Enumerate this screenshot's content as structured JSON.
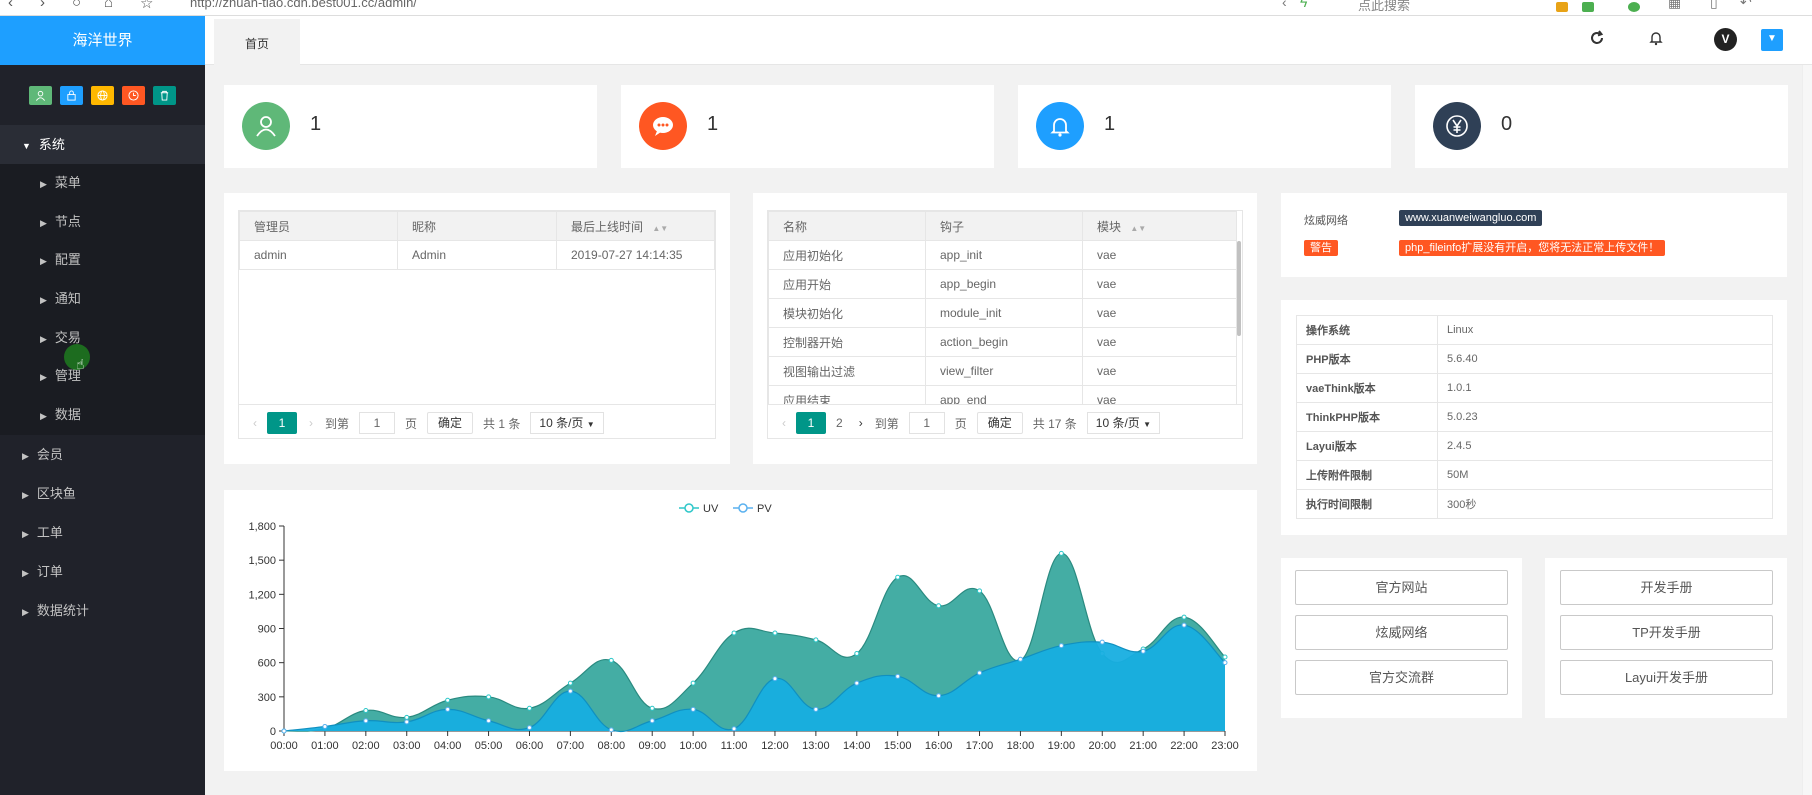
{
  "browser": {
    "url": "http://zhuan-tiao.cdn.best001.cc/admin/",
    "search_placeholder": "点此搜索"
  },
  "sidebar": {
    "logo": "海洋世界",
    "tools": [
      {
        "icon": "user-icon",
        "color": "#5fb878"
      },
      {
        "icon": "lock-icon",
        "color": "#1e9fff"
      },
      {
        "icon": "globe-icon",
        "color": "#ffb800"
      },
      {
        "icon": "clock-icon",
        "color": "#ff5722"
      },
      {
        "icon": "trash-icon",
        "color": "#009688"
      }
    ],
    "menu": [
      {
        "label": "系统",
        "open": true,
        "children": [
          "菜单",
          "节点",
          "配置",
          "通知",
          "交易",
          "管理",
          "数据"
        ]
      },
      {
        "label": "会员"
      },
      {
        "label": "区块鱼"
      },
      {
        "label": "工单"
      },
      {
        "label": "订单"
      },
      {
        "label": "数据统计"
      }
    ]
  },
  "topnav": {
    "tab_home": "首页",
    "avatar": "V"
  },
  "stats": [
    {
      "icon": "user-icon",
      "color": "#5fb878",
      "value": "1"
    },
    {
      "icon": "chat-icon",
      "color": "#ff5722",
      "value": "1"
    },
    {
      "icon": "bell-icon",
      "color": "#1e9fff",
      "value": "1"
    },
    {
      "icon": "yen-icon",
      "color": "#2f4056",
      "value": "0"
    }
  ],
  "admin_table": {
    "headers": [
      "管理员",
      "昵称",
      "最后上线时间"
    ],
    "rows": [
      [
        "admin",
        "Admin",
        "2019-07-27 14:14:35"
      ]
    ],
    "pager": {
      "current": "1",
      "goto_label": "到第",
      "goto_value": "1",
      "page_label": "页",
      "confirm": "确定",
      "total": "共 1 条",
      "per_page": "10 条/页"
    }
  },
  "hook_table": {
    "headers": [
      "名称",
      "钩子",
      "模块"
    ],
    "rows": [
      [
        "应用初始化",
        "app_init",
        "vae"
      ],
      [
        "应用开始",
        "app_begin",
        "vae"
      ],
      [
        "模块初始化",
        "module_init",
        "vae"
      ],
      [
        "控制器开始",
        "action_begin",
        "vae"
      ],
      [
        "视图输出过滤",
        "view_filter",
        "vae"
      ],
      [
        "应用结束",
        "app_end",
        "vae"
      ]
    ],
    "pager": {
      "current": "1",
      "page2": "2",
      "goto_label": "到第",
      "goto_value": "1",
      "page_label": "页",
      "confirm": "确定",
      "total": "共 17 条",
      "per_page": "10 条/页"
    }
  },
  "notice": {
    "brand_label": "炫威网络",
    "brand_url": "www.xuanweiwangluo.com",
    "warn_label": "警告",
    "warn_text": "php_fileinfo扩展没有开启，您将无法正常上传文件！"
  },
  "sysinfo": [
    [
      "操作系统",
      "Linux"
    ],
    [
      "PHP版本",
      "5.6.40"
    ],
    [
      "vaeThink版本",
      "1.0.1"
    ],
    [
      "ThinkPHP版本",
      "5.0.23"
    ],
    [
      "Layui版本",
      "2.4.5"
    ],
    [
      "上传附件限制",
      "50M"
    ],
    [
      "执行时间限制",
      "300秒"
    ]
  ],
  "links_left": [
    "官方网站",
    "炫威网络",
    "官方交流群"
  ],
  "links_right": [
    "开发手册",
    "TP开发手册",
    "Layui开发手册"
  ],
  "chart_data": {
    "type": "area",
    "x": [
      "00:00",
      "01:00",
      "02:00",
      "03:00",
      "04:00",
      "05:00",
      "06:00",
      "07:00",
      "08:00",
      "09:00",
      "10:00",
      "11:00",
      "12:00",
      "13:00",
      "14:00",
      "15:00",
      "16:00",
      "17:00",
      "18:00",
      "19:00",
      "20:00",
      "21:00",
      "22:00",
      "23:00"
    ],
    "series": [
      {
        "name": "UV",
        "color": "#2ec7c9",
        "values": [
          0,
          20,
          180,
          120,
          270,
          300,
          200,
          420,
          620,
          200,
          420,
          860,
          860,
          800,
          680,
          1350,
          1100,
          1230,
          620,
          1560,
          680,
          720,
          1000,
          650
        ]
      },
      {
        "name": "PV",
        "color": "#5ab1ef",
        "values": [
          0,
          40,
          90,
          80,
          190,
          90,
          30,
          350,
          10,
          90,
          190,
          20,
          460,
          190,
          420,
          480,
          310,
          510,
          630,
          750,
          780,
          700,
          930,
          600
        ]
      }
    ],
    "yticks": [
      "0",
      "300",
      "600",
      "900",
      "1,200",
      "1,500",
      "1,800"
    ],
    "ylim": [
      0,
      1800
    ],
    "legend": "top-center"
  }
}
